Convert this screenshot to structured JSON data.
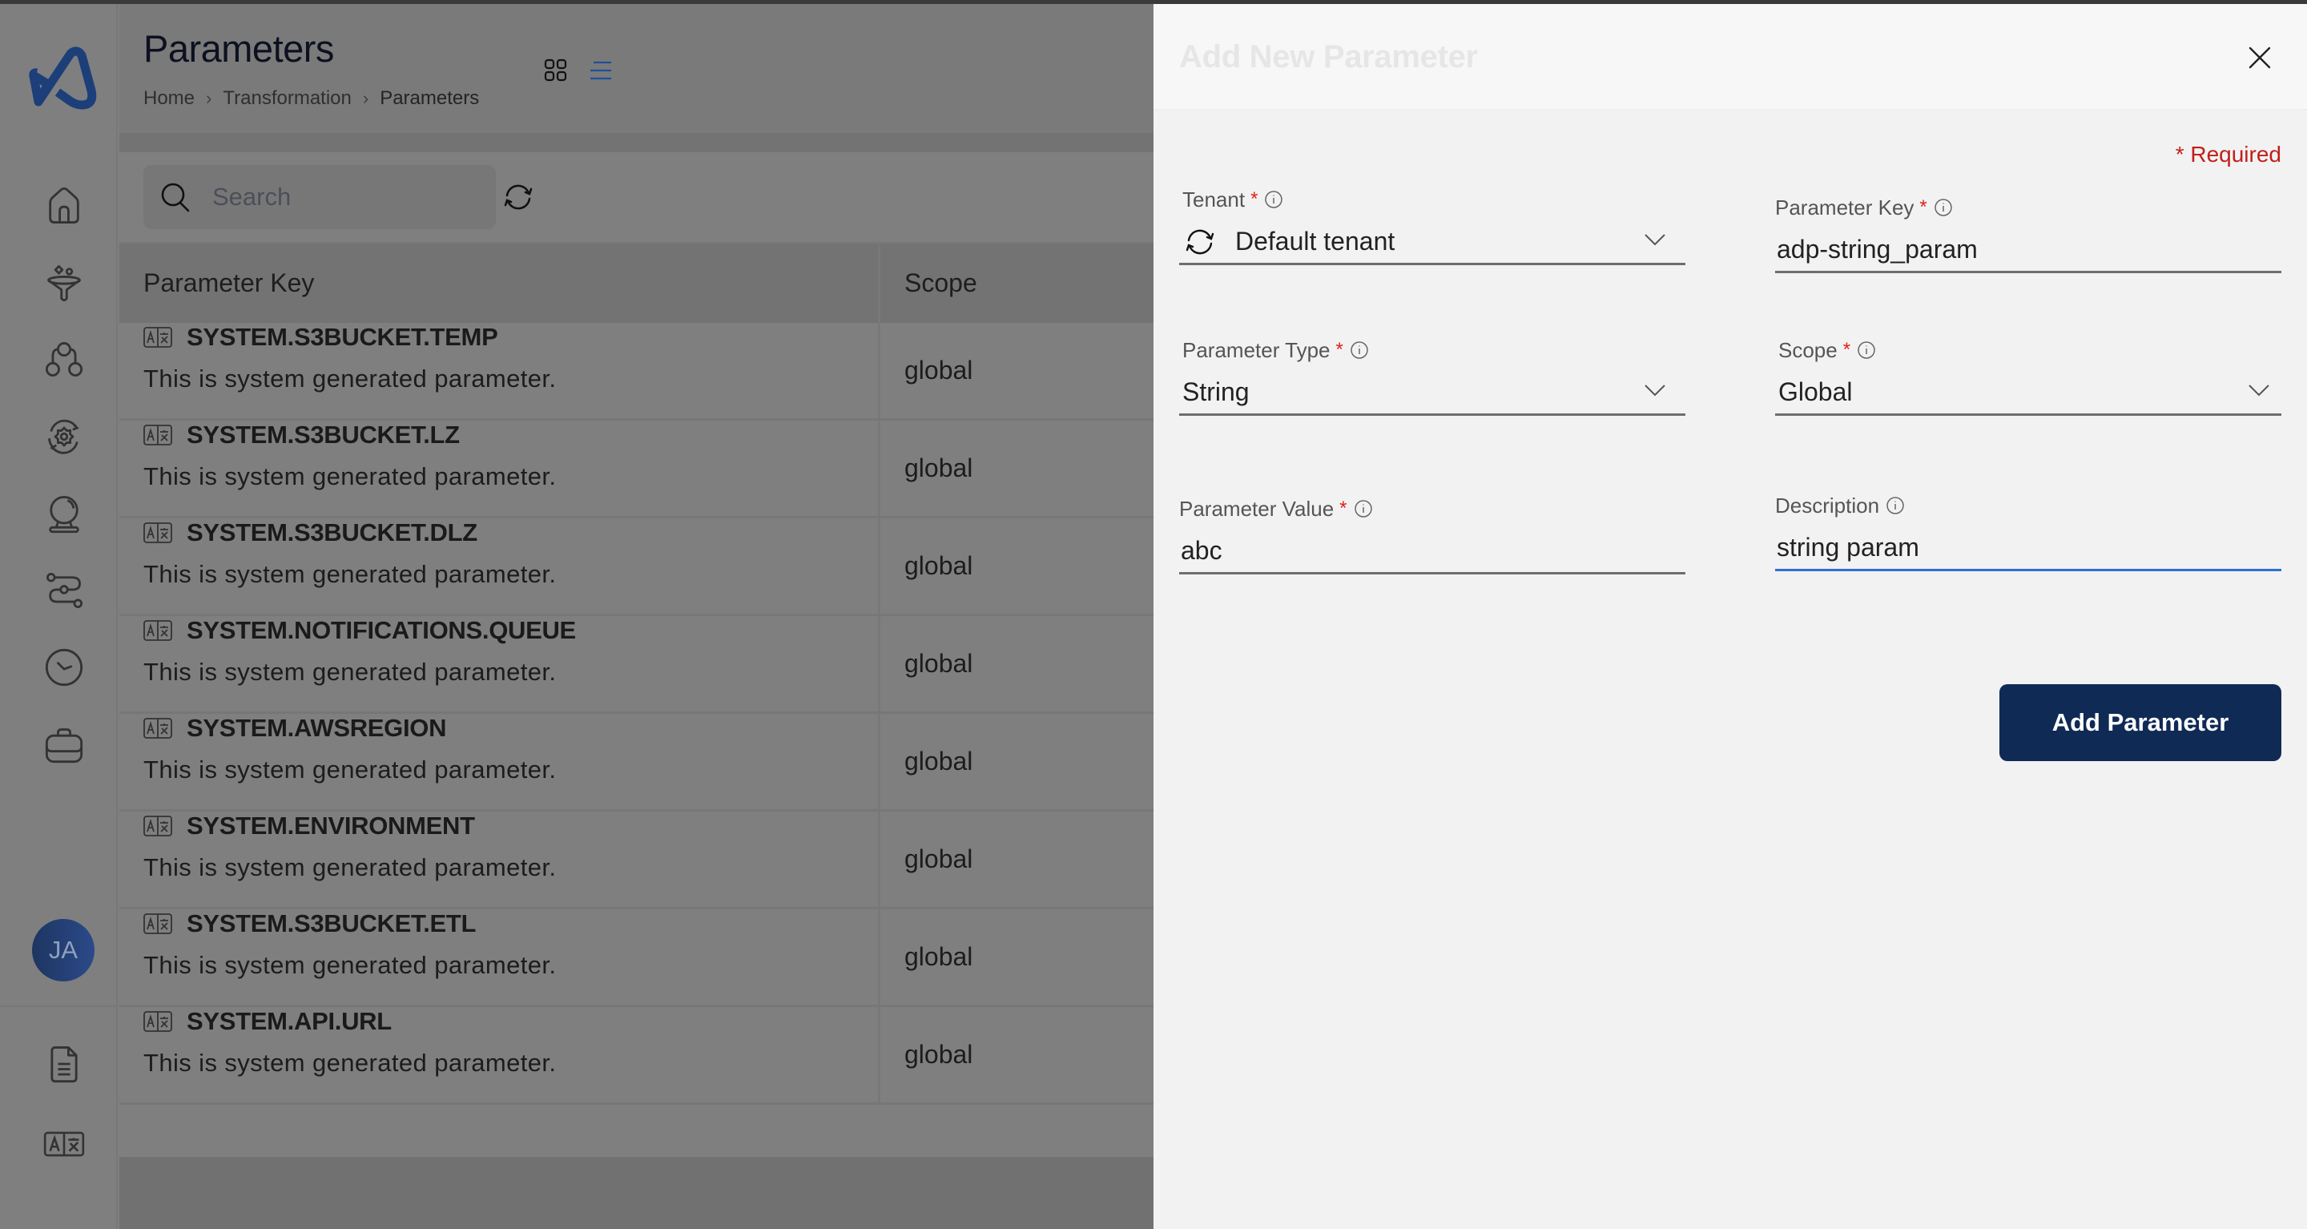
{
  "app": {
    "page_title": "Parameters",
    "breadcrumb": [
      {
        "label": "Home"
      },
      {
        "label": "Transformation"
      },
      {
        "label": "Parameters"
      }
    ],
    "view_modes": {
      "grid": "grid-view-icon",
      "list": "list-view-icon",
      "active": "list"
    },
    "search": {
      "placeholder": "Search",
      "value": ""
    },
    "sidebar": {
      "items": [
        {
          "name": "home",
          "icon": "home-icon"
        },
        {
          "name": "ingestion",
          "icon": "funnel-icon"
        },
        {
          "name": "hierarchy",
          "icon": "hierarchy-icon"
        },
        {
          "name": "processing",
          "icon": "gear-cycle-icon"
        },
        {
          "name": "insights",
          "icon": "crystal-ball-icon"
        },
        {
          "name": "workflow",
          "icon": "route-icon"
        },
        {
          "name": "scheduler",
          "icon": "clock-icon"
        },
        {
          "name": "jobs",
          "icon": "briefcase-icon"
        }
      ],
      "user_initials": "JA",
      "bottom_items": [
        {
          "name": "documents",
          "icon": "document-icon"
        },
        {
          "name": "parameters",
          "icon": "translate-icon"
        }
      ]
    },
    "table": {
      "columns": [
        "Parameter Key",
        "Scope"
      ],
      "rows": [
        {
          "key": "SYSTEM.S3BUCKET.TEMP",
          "description": "This is system generated parameter.",
          "scope": "global"
        },
        {
          "key": "SYSTEM.S3BUCKET.LZ",
          "description": "This is system generated parameter.",
          "scope": "global"
        },
        {
          "key": "SYSTEM.S3BUCKET.DLZ",
          "description": "This is system generated parameter.",
          "scope": "global"
        },
        {
          "key": "SYSTEM.NOTIFICATIONS.QUEUE",
          "description": "This is system generated parameter.",
          "scope": "global"
        },
        {
          "key": "SYSTEM.AWSREGION",
          "description": "This is system generated parameter.",
          "scope": "global"
        },
        {
          "key": "SYSTEM.ENVIRONMENT",
          "description": "This is system generated parameter.",
          "scope": "global"
        },
        {
          "key": "SYSTEM.S3BUCKET.ETL",
          "description": "This is system generated parameter.",
          "scope": "global"
        },
        {
          "key": "SYSTEM.API.URL",
          "description": "This is system generated parameter.",
          "scope": "global"
        }
      ]
    }
  },
  "drawer": {
    "title": "Add New Parameter",
    "required_note": "* Required",
    "fields": {
      "tenant": {
        "label": "Tenant",
        "required": "*",
        "value": "Default tenant",
        "type": "select"
      },
      "parameter_key": {
        "label": "Parameter Key",
        "required": "*",
        "value": "adp-string_param",
        "type": "text"
      },
      "parameter_type": {
        "label": "Parameter Type",
        "required": "*",
        "value": "String",
        "type": "select"
      },
      "scope": {
        "label": "Scope",
        "required": "*",
        "value": "Global",
        "type": "select"
      },
      "parameter_value": {
        "label": "Parameter Value",
        "required": "*",
        "value": "abc",
        "type": "text"
      },
      "description": {
        "label": "Description",
        "value": "string param",
        "type": "text",
        "focused": true
      }
    },
    "submit_label": "Add Parameter"
  },
  "colors": {
    "brand": "#1c3f7a",
    "primary_button": "#0f2a55",
    "required": "#c0201c",
    "focus_underline": "#2f6fd6",
    "overlay": "#7f7f7f"
  }
}
